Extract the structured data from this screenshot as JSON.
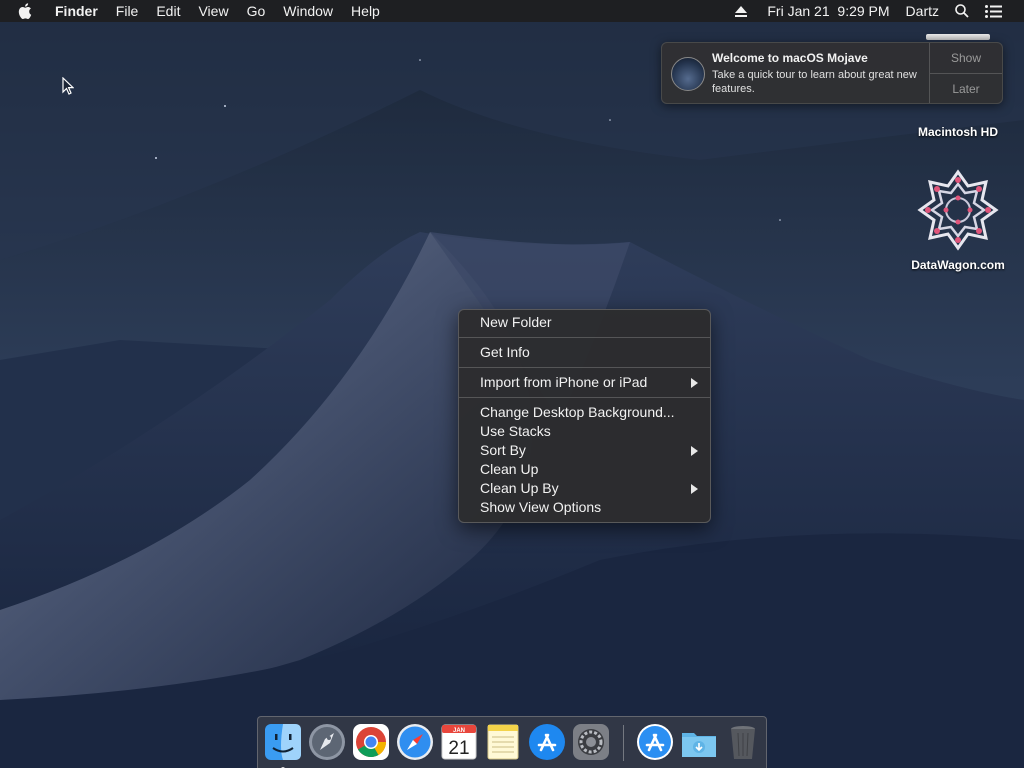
{
  "menubar": {
    "apple_icon": "apple-logo-icon",
    "app_name": "Finder",
    "menus": [
      "File",
      "Edit",
      "View",
      "Go",
      "Window",
      "Help"
    ],
    "eject_icon": "eject-icon",
    "datetime": "Fri Jan 21  9:29 PM",
    "user": "Dartz",
    "search_icon": "spotlight-search-icon",
    "notification_center_icon": "notification-center-icon"
  },
  "notification": {
    "title": "Welcome to macOS Mojave",
    "body": "Take a quick tour to learn about great new features.",
    "show_label": "Show",
    "later_label": "Later"
  },
  "desktop_icons": [
    {
      "label": "Macintosh HD",
      "icon": "hard-drive-icon"
    },
    {
      "label": "DataWagon.com",
      "icon": "datawagon-logo-icon"
    }
  ],
  "context_menu": {
    "groups": [
      [
        "New Folder"
      ],
      [
        "Get Info"
      ],
      [
        "Import from iPhone or iPad"
      ],
      [
        "Change Desktop Background...",
        "Use Stacks",
        "Sort By",
        "Clean Up",
        "Clean Up By",
        "Show View Options"
      ]
    ],
    "submenu_items": [
      "Import from iPhone or iPad",
      "Sort By",
      "Clean Up By"
    ]
  },
  "dock": {
    "apps": [
      {
        "name": "Finder",
        "icon": "finder-icon",
        "running": true
      },
      {
        "name": "Launchpad",
        "icon": "launchpad-icon"
      },
      {
        "name": "Google Chrome",
        "icon": "chrome-icon"
      },
      {
        "name": "Safari",
        "icon": "safari-icon"
      },
      {
        "name": "Calendar",
        "icon": "calendar-icon",
        "month": "JAN",
        "day": "21"
      },
      {
        "name": "Notes",
        "icon": "notes-icon"
      },
      {
        "name": "App Store",
        "icon": "app-store-icon"
      },
      {
        "name": "System Preferences",
        "icon": "system-preferences-icon"
      },
      {
        "name": "Applications",
        "icon": "app-store-icon"
      },
      {
        "name": "Downloads",
        "icon": "downloads-folder-icon"
      },
      {
        "name": "Trash",
        "icon": "trash-icon"
      }
    ]
  }
}
